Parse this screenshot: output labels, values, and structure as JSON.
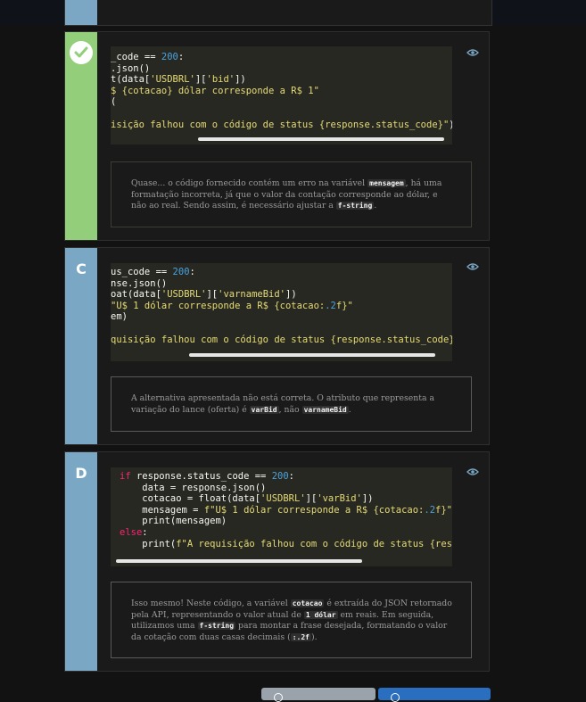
{
  "option_b": {
    "code_lines": [
      "_code == 200:",
      ".json()",
      "t(data['USDBRL']['bid'])",
      "$ {cotacao} dólar corresponde a R$ 1\"",
      "(",
      "",
      "isição falhou com o código de status {response.status_code}\")"
    ],
    "feedback": {
      "p1": "Quase... o código fornecido contém um erro na variável ",
      "tag1": "mensagem",
      "p2": ", há uma formatação incorreta, já que o valor da contação corresponde ao dólar, e não ao real. Sendo assim, é necessário ajustar a ",
      "tag2": "f-string",
      "p3": "."
    }
  },
  "option_c": {
    "letter": "C",
    "code_lines": [
      "us_code == 200:",
      "nse.json()",
      "oat(data['USDBRL']['varnameBid'])",
      "\"U$ 1 dólar corresponde a R$ {cotacao:.2f}\"",
      "em)",
      "",
      "quisição falhou com o código de status {response.status_code}"
    ],
    "feedback": {
      "p1": "A alternativa apresentada não está correta. O atributo que representa a variação do lance (oferta) é ",
      "tag1": "varBid",
      "p2": ", não ",
      "tag2": "varnameBid",
      "p3": "."
    }
  },
  "option_d": {
    "letter": "D",
    "code_lines": [
      "if response.status_code == 200:",
      "    data = response.json()",
      "    cotacao = float(data['USDBRL']['varBid'])",
      "    mensagem = f\"U$ 1 dólar corresponde a R$ {cotacao:.2f}\"",
      "    print(mensagem)",
      "else:",
      "    print(f\"A requisição falhou com o código de status {resp"
    ],
    "feedback": {
      "p1": "Isso mesmo! Neste código, a variável ",
      "tag1": "cotacao",
      "p2": " é extraída do JSON retornado pela API, representando o valor atual de ",
      "tag2": "1 dólar",
      "p3": " em reais. Em seguida, utilizamos uma ",
      "tag3": "f-string",
      "p4": " para montar a frase desejada, formatando o valor da cotação com duas casas decimais (",
      "tag4": ":.2f",
      "p5": ")."
    }
  },
  "icons": {
    "selected": "check-icon",
    "reveal": "eye-icon"
  },
  "colors": {
    "correct_strip": "#93cf7a",
    "option_strip": "#7aa8c4",
    "primary_button": "#2a6fbf",
    "secondary_button": "#9aa3ab"
  }
}
